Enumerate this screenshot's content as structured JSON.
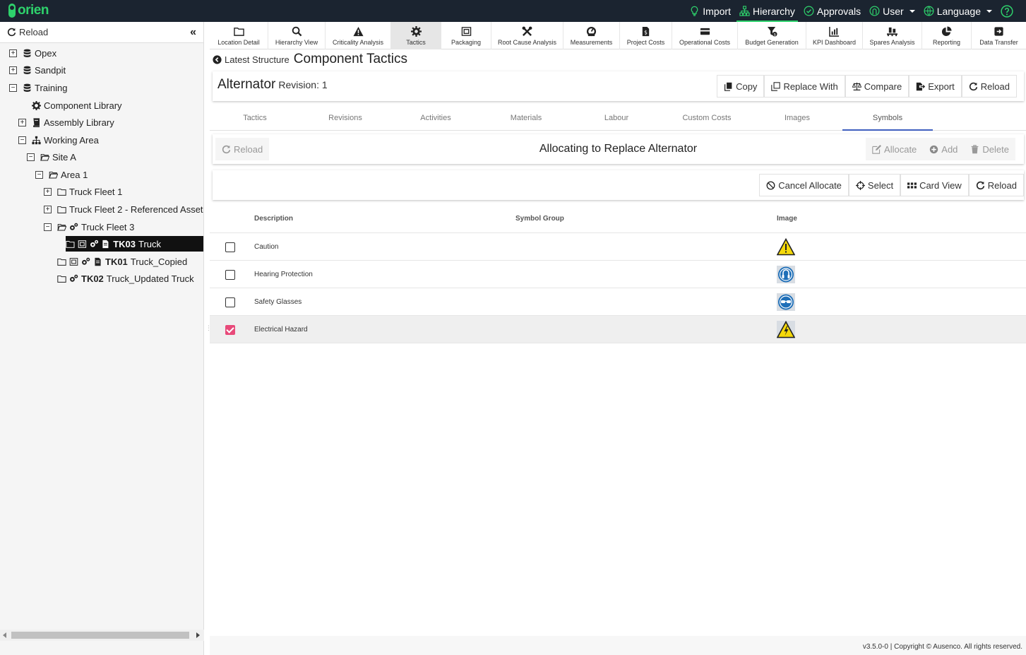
{
  "app": {
    "logo_text": "orien"
  },
  "topnav": [
    {
      "label": "Import",
      "icon": "lightbulb-icon"
    },
    {
      "label": "Hierarchy",
      "icon": "hierarchy-icon",
      "active": true
    },
    {
      "label": "Approvals",
      "icon": "check-circle-icon"
    },
    {
      "label": "User",
      "icon": "user-icon",
      "dropdown": true
    },
    {
      "label": "Language",
      "icon": "globe-icon",
      "dropdown": true
    },
    {
      "label": "",
      "icon": "help-icon"
    }
  ],
  "sidebar": {
    "reload_label": "Reload",
    "collapse_glyph": "«",
    "tree": [
      {
        "label": "Opex",
        "toggle": "+"
      },
      {
        "label": "Sandpit",
        "toggle": "+"
      },
      {
        "label": "Training",
        "toggle": "−"
      },
      {
        "label": "Component Library",
        "toggle": ""
      },
      {
        "label": "Assembly Library",
        "toggle": "+"
      },
      {
        "label": "Working Area",
        "toggle": "−"
      },
      {
        "label": "Site A",
        "toggle": "−"
      },
      {
        "label": "Area 1",
        "toggle": "−"
      },
      {
        "label": "Truck Fleet 1",
        "toggle": "+"
      },
      {
        "label": "Truck Fleet 2 - Referenced Asset",
        "toggle": "+"
      },
      {
        "label": "Truck Fleet 3",
        "toggle": "−"
      },
      {
        "code": "TK03",
        "label": "Truck",
        "selected": true
      },
      {
        "code": "TK01",
        "label": "Truck_Copied"
      },
      {
        "code": "TK02",
        "label": "Truck_Updated Truck"
      }
    ]
  },
  "toolbar": [
    {
      "label": "Location Detail",
      "icon": "folder-icon"
    },
    {
      "label": "Hierarchy View",
      "icon": "search-icon"
    },
    {
      "label": "Criticality Analysis",
      "icon": "warning-icon"
    },
    {
      "label": "Tactics",
      "icon": "gear-icon",
      "active": true
    },
    {
      "label": "Packaging",
      "icon": "package-icon"
    },
    {
      "label": "Root Cause Analysis",
      "icon": "tools-icon"
    },
    {
      "label": "Measurements",
      "icon": "gauge-icon"
    },
    {
      "label": "Project Costs",
      "icon": "document-dollar-icon"
    },
    {
      "label": "Operational Costs",
      "icon": "credit-card-icon"
    },
    {
      "label": "Budget Generation",
      "icon": "funnel-dollar-icon"
    },
    {
      "label": "KPI Dashboard",
      "icon": "bar-chart-icon"
    },
    {
      "label": "Spares Analysis",
      "icon": "pallet-icon"
    },
    {
      "label": "Reporting",
      "icon": "pie-chart-icon"
    },
    {
      "label": "Data Transfer",
      "icon": "transfer-icon"
    }
  ],
  "breadcrumb": {
    "back_label": "Latest Structure",
    "title": "Component Tactics"
  },
  "component": {
    "name": "Alternator",
    "revision": "Revision: 1",
    "actions": [
      "Copy",
      "Replace With",
      "Compare",
      "Export",
      "Reload"
    ]
  },
  "tabs": [
    "Tactics",
    "Revisions",
    "Activities",
    "Materials",
    "Labour",
    "Custom Costs",
    "Images",
    "Symbols"
  ],
  "active_tab": "Symbols",
  "allocation": {
    "reload_label": "Reload",
    "heading": "Allocating to Replace Alternator",
    "actions": [
      "Allocate",
      "Add",
      "Delete"
    ]
  },
  "selection": {
    "actions": [
      "Cancel Allocate",
      "Select",
      "Card View",
      "Reload"
    ]
  },
  "grid": {
    "columns": [
      "Description",
      "Symbol Group",
      "Image"
    ],
    "rows": [
      {
        "description": "Caution",
        "symbol_group": "",
        "image": "caution-sign-icon",
        "checked": false
      },
      {
        "description": "Hearing Protection",
        "symbol_group": "",
        "image": "hearing-protection-sign-icon",
        "checked": false
      },
      {
        "description": "Safety Glasses",
        "symbol_group": "",
        "image": "safety-glasses-sign-icon",
        "checked": false
      },
      {
        "description": "Electrical Hazard",
        "symbol_group": "",
        "image": "electrical-hazard-sign-icon",
        "checked": true
      }
    ]
  },
  "footer": "v3.5.0-0 | Copyright © Ausenco. All rights reserved.",
  "colors": {
    "topbar": "#1b2430",
    "brand": "#2ed26c",
    "tab_active": "#3f5fbf",
    "checkbox_on": "#e84a7a"
  }
}
